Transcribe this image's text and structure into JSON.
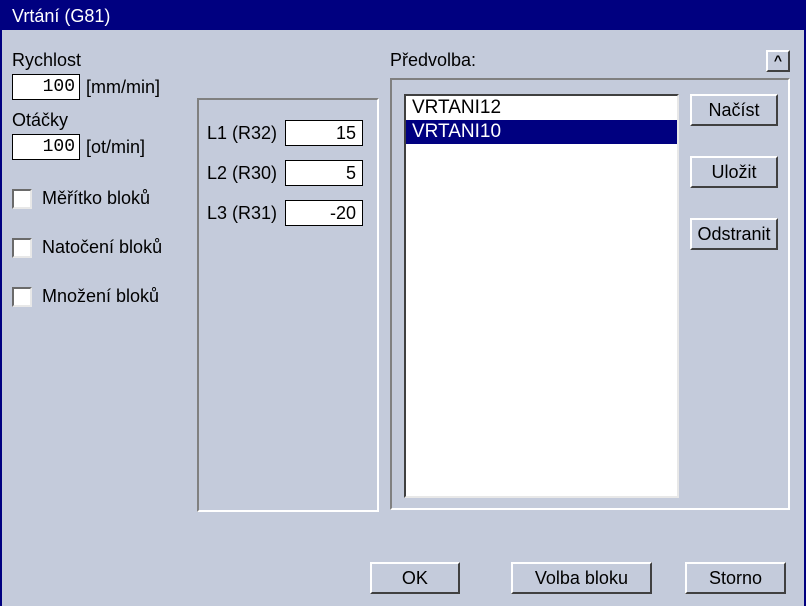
{
  "title": "Vrtání (G81)",
  "left": {
    "speed_label": "Rychlost",
    "speed_value": "100",
    "speed_unit": "[mm/min]",
    "rpm_label": "Otáčky",
    "rpm_value": "100",
    "rpm_unit": "[ot/min]",
    "cb_scale": "Měřítko bloků",
    "cb_rotate": "Natočení bloků",
    "cb_multiply": "Množení bloků"
  },
  "middle": {
    "l1_label": "L1 (R32)",
    "l1_value": "15",
    "l2_label": "L2 (R30)",
    "l2_value": "5",
    "l3_label": "L3 (R31)",
    "l3_value": "-20"
  },
  "preset": {
    "title": "Předvolba:",
    "caret": "^",
    "items": [
      "VRTANI12",
      "VRTANI10"
    ],
    "selected_index": 1,
    "btn_load": "Načíst",
    "btn_save": "Uložit",
    "btn_delete": "Odstranit"
  },
  "bottom": {
    "ok": "OK",
    "block": "Volba bloku",
    "cancel": "Storno"
  }
}
